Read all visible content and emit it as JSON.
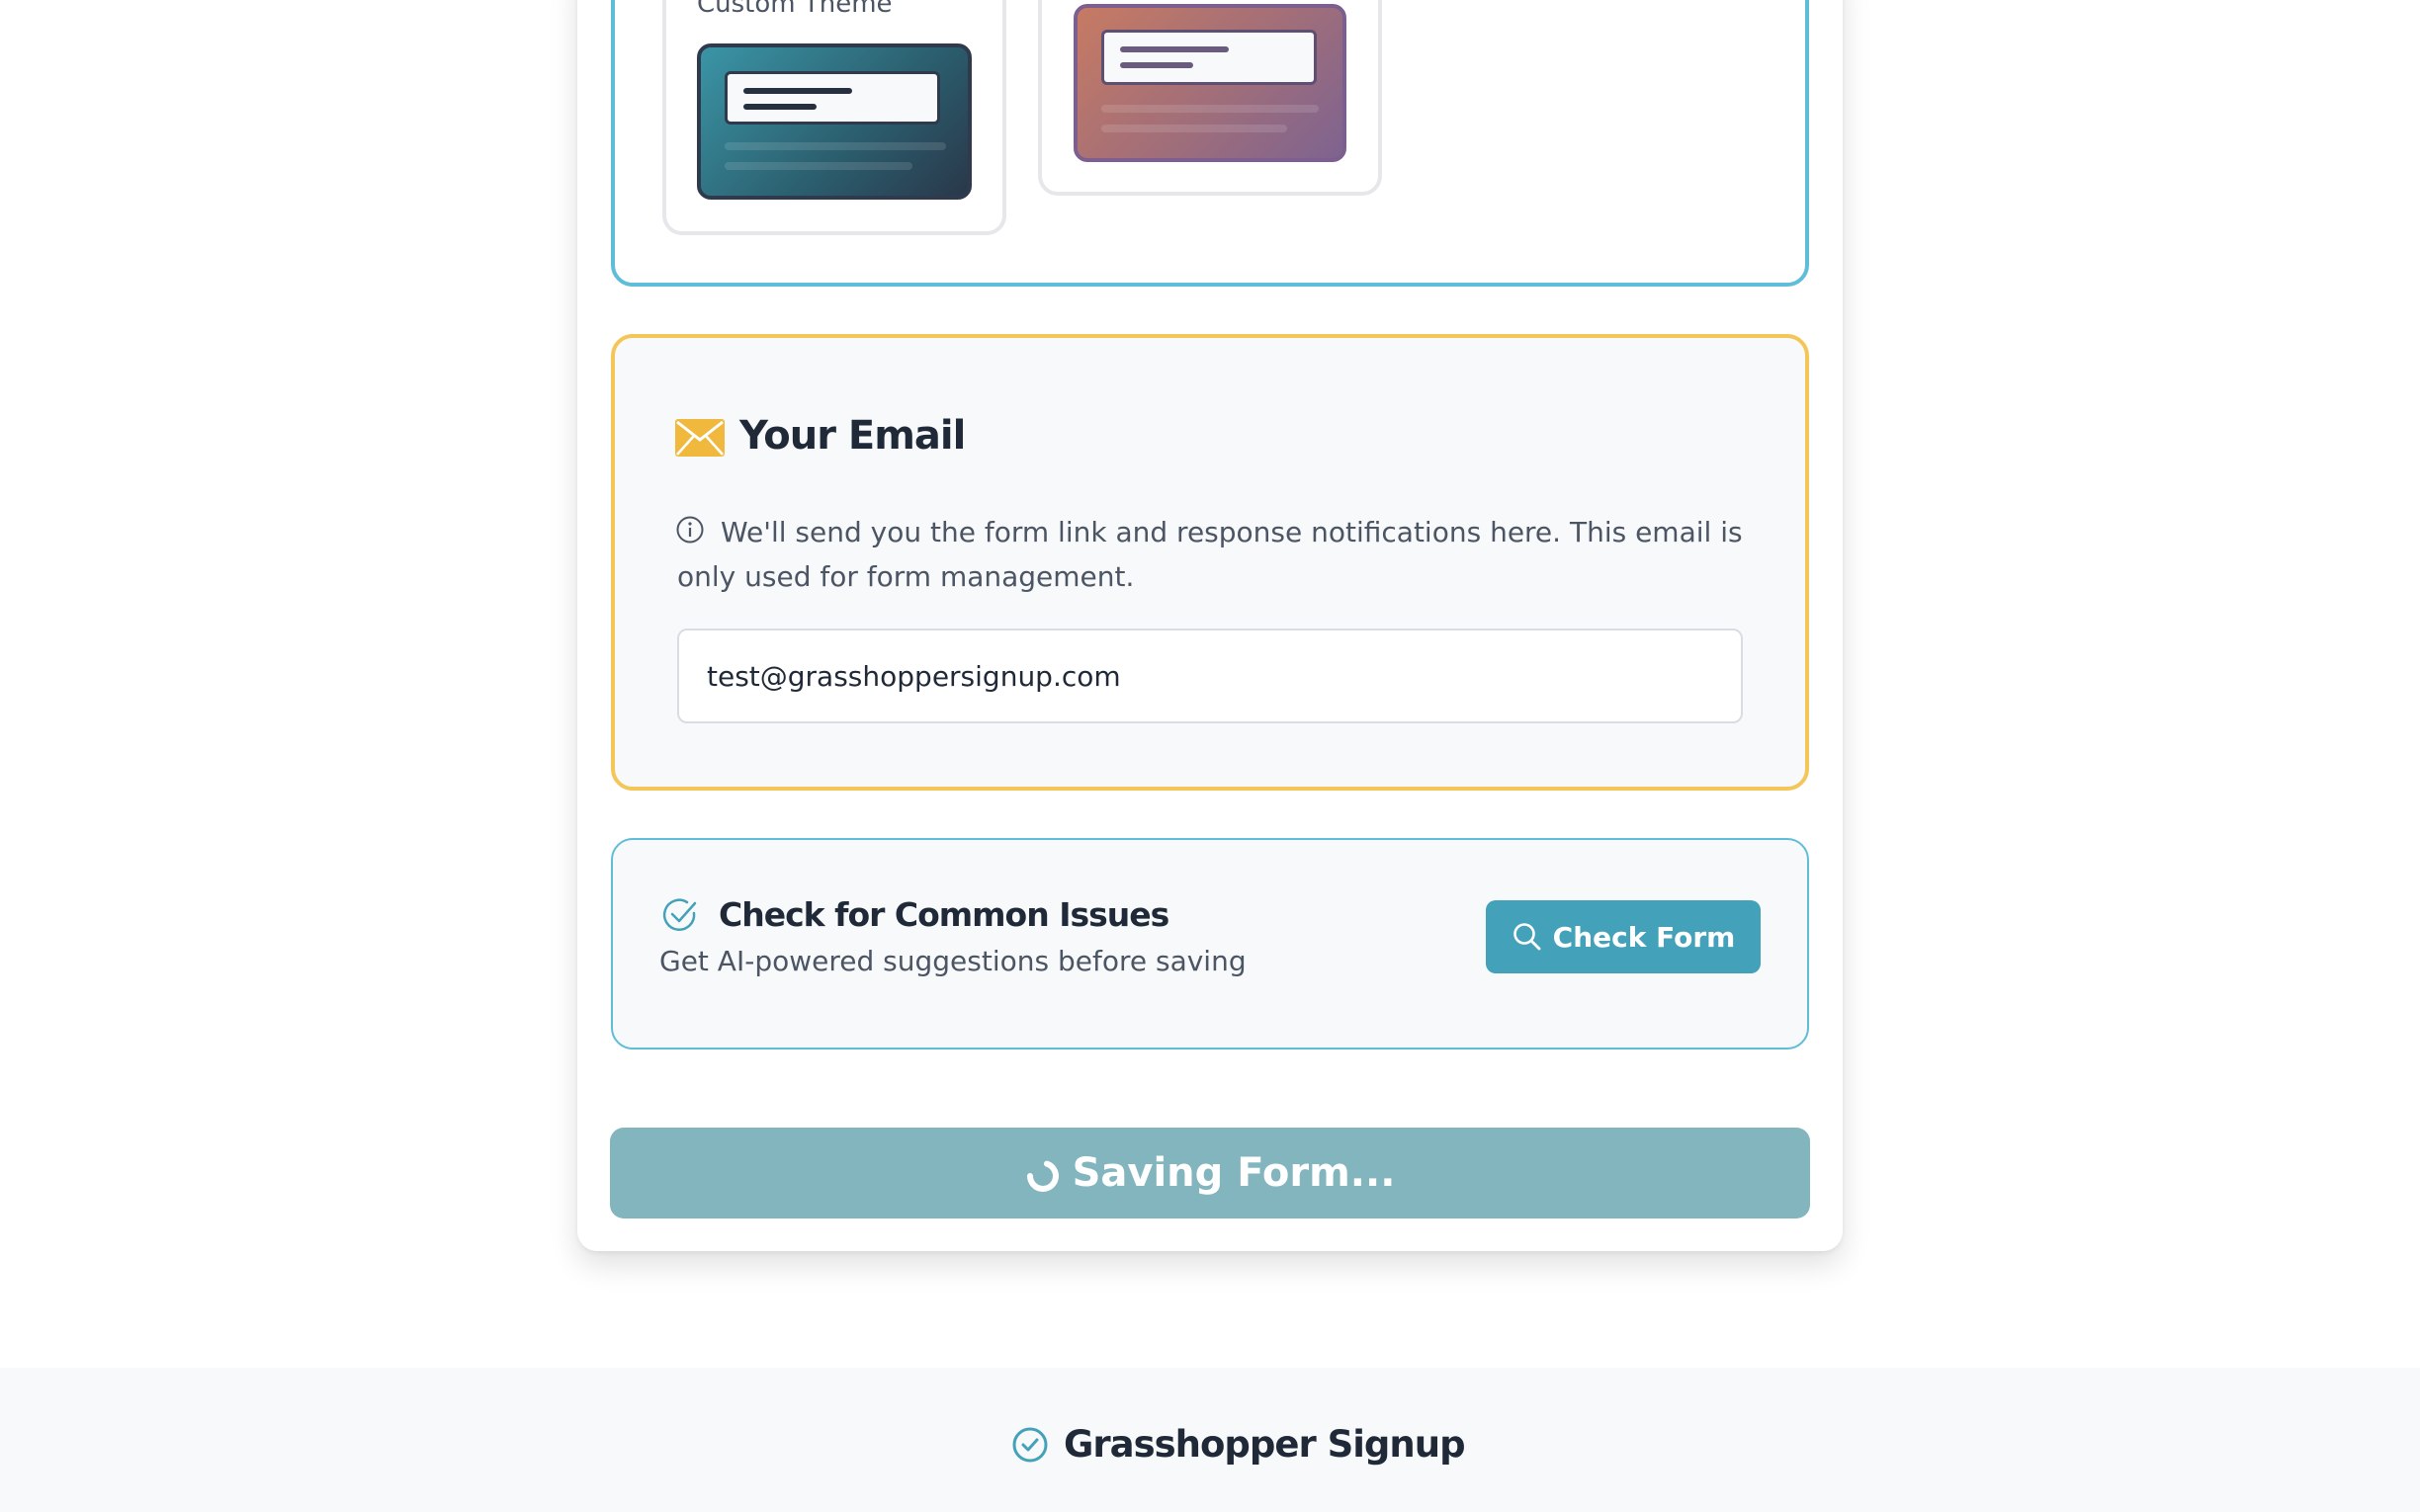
{
  "theme_picker": {
    "custom_theme_label": "Custom Theme"
  },
  "email": {
    "title": "Your Email",
    "help_text": "We'll send you the form link and response notifications here. This email is only used for form management.",
    "value": "test@grasshoppersignup.com",
    "icon": "envelope-icon",
    "accent_color": "#f4c65a"
  },
  "checker": {
    "title": "Check for Common Issues",
    "subtitle": "Get AI-powered suggestions before saving",
    "button_label": "Check Form",
    "button_icon": "search-icon",
    "accent_color": "#43a2b9"
  },
  "save": {
    "label": "Saving Form...",
    "icon": "spinner-icon",
    "state": "loading"
  },
  "footer": {
    "brand_name": "Grasshopper Signup",
    "icon": "check-circle-icon"
  }
}
